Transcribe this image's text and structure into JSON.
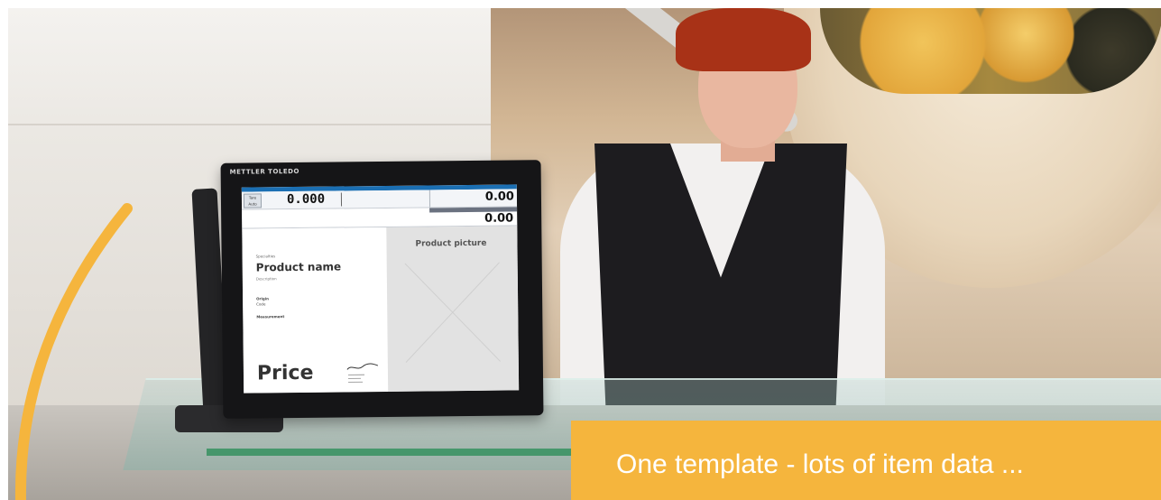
{
  "monitor": {
    "brand": "METTLER TOLEDO",
    "tare_button": "Tare\nAuto",
    "weight": "0.000",
    "price_top": "0.00",
    "price_bottom": "0.00",
    "product": {
      "category": "Specialties",
      "name": "Product name",
      "description": "Description",
      "origin_label": "Origin",
      "origin_value": "Code",
      "measurement": "Measurement",
      "price_label": "Price"
    },
    "picture_label": "Product picture"
  },
  "caption": {
    "text": "One template - lots of item data ..."
  },
  "colors": {
    "accent_yellow": "#f5b53d",
    "screen_blue": "#1b6fb3"
  }
}
